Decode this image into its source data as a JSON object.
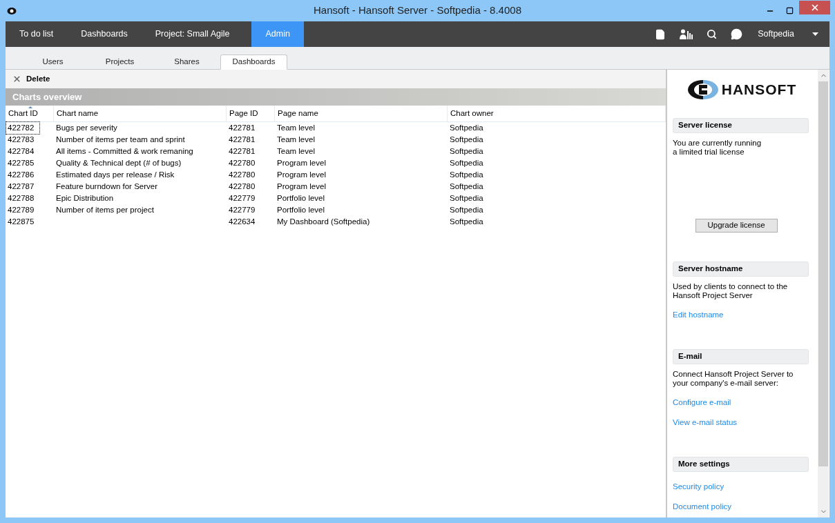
{
  "window": {
    "title": "Hansoft - Hansoft Server - Softpedia - 8.4008"
  },
  "nav": {
    "items": [
      {
        "label": "To do list",
        "selected": false
      },
      {
        "label": "Dashboards",
        "selected": false
      },
      {
        "label": "Project: Small Agile",
        "selected": false
      },
      {
        "label": "Admin",
        "selected": true
      }
    ],
    "user": "Softpedia"
  },
  "tabs": [
    {
      "label": "Users",
      "selected": false
    },
    {
      "label": "Projects",
      "selected": false
    },
    {
      "label": "Shares",
      "selected": false
    },
    {
      "label": "Dashboards",
      "selected": true
    }
  ],
  "toolbar": {
    "delete": "Delete"
  },
  "table": {
    "title": "Charts overview",
    "columns": [
      {
        "label": "Chart ID",
        "sorted": true
      },
      {
        "label": "Chart name",
        "sorted": false
      },
      {
        "label": "Page ID",
        "sorted": false
      },
      {
        "label": "Page name",
        "sorted": false
      },
      {
        "label": "Chart owner",
        "sorted": false
      }
    ],
    "rows": [
      {
        "focused": true,
        "cells": [
          "422782",
          "Bugs per severity",
          "422781",
          "Team level",
          "Softpedia"
        ]
      },
      {
        "focused": false,
        "cells": [
          "422783",
          "Number of items per team and sprint",
          "422781",
          "Team level",
          "Softpedia"
        ]
      },
      {
        "focused": false,
        "cells": [
          "422784",
          "All items - Committed & work remaning",
          "422781",
          "Team level",
          "Softpedia"
        ]
      },
      {
        "focused": false,
        "cells": [
          "422785",
          "Quality & Technical dept (# of bugs)",
          "422780",
          "Program level",
          "Softpedia"
        ]
      },
      {
        "focused": false,
        "cells": [
          "422786",
          "Estimated days per release / Risk",
          "422780",
          "Program level",
          "Softpedia"
        ]
      },
      {
        "focused": false,
        "cells": [
          "422787",
          "Feature burndown for Server",
          "422780",
          "Program level",
          "Softpedia"
        ]
      },
      {
        "focused": false,
        "cells": [
          "422788",
          "Epic Distribution",
          "422779",
          "Portfolio level",
          "Softpedia"
        ]
      },
      {
        "focused": false,
        "cells": [
          "422789",
          "Number of items per project",
          "422779",
          "Portfolio level",
          "Softpedia"
        ]
      },
      {
        "focused": false,
        "cells": [
          "422875",
          "",
          "422634",
          "My Dashboard (Softpedia)",
          "Softpedia"
        ]
      }
    ]
  },
  "side_panel": {
    "logo": "HANSOFT",
    "sections": [
      {
        "heading": "Server license",
        "items": [
          {
            "kind": "text",
            "lines": [
              "You are currently running",
              "a limited trial license"
            ]
          },
          {
            "kind": "button",
            "label": "Upgrade license"
          }
        ]
      },
      {
        "heading": "Server hostname",
        "items": [
          {
            "kind": "text",
            "lines": [
              "Used by clients to connect to the",
              "Hansoft Project Server"
            ]
          },
          {
            "kind": "link",
            "label": "Edit hostname"
          }
        ]
      },
      {
        "heading": "E-mail",
        "items": [
          {
            "kind": "text",
            "lines": [
              "Connect Hansoft Project Server to",
              "your company's e-mail server:"
            ]
          },
          {
            "kind": "link",
            "label": "Configure e-mail"
          },
          {
            "kind": "link",
            "label": "View e-mail status"
          }
        ]
      },
      {
        "heading": "More settings",
        "items": [
          {
            "kind": "link",
            "label": "Security policy"
          },
          {
            "kind": "link",
            "label": "Document policy"
          }
        ]
      }
    ]
  }
}
